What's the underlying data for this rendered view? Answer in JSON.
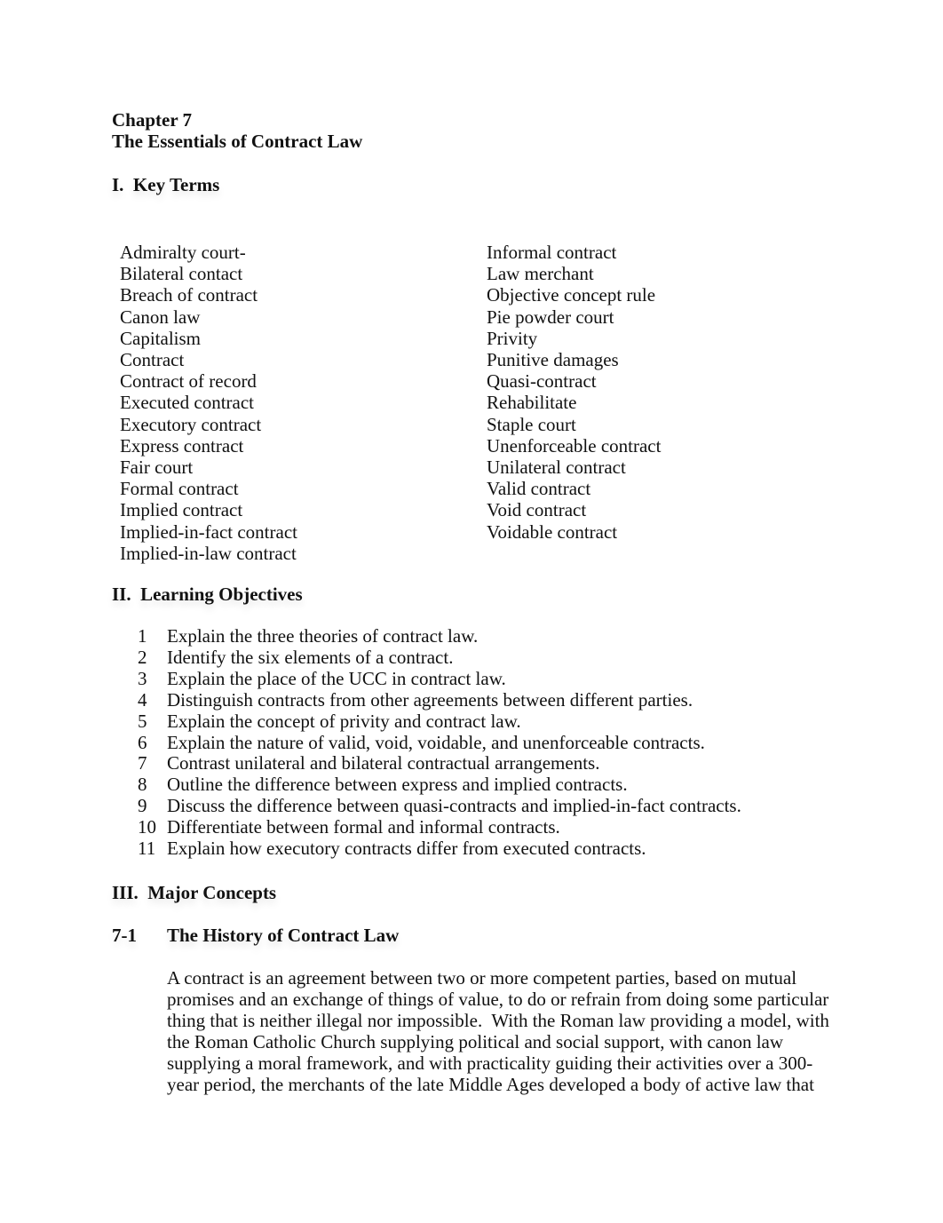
{
  "document": {
    "chapter": "Chapter 7",
    "title": "The Essentials of Contract Law"
  },
  "sections": {
    "key_terms": {
      "heading": "I.  Key Terms",
      "left_column": [
        "Admiralty court-",
        "Bilateral contact",
        "Breach of contract",
        "Canon law",
        "Capitalism",
        "Contract",
        "Contract of record",
        "Executed contract",
        "Executory contract",
        "Express contract",
        "Fair court",
        "Formal contract",
        "Implied contract",
        "Implied-in-fact contract",
        "Implied-in-law contract"
      ],
      "right_column": [
        "Informal contract",
        "Law merchant",
        "Objective concept rule",
        "Pie powder court",
        "Privity",
        "Punitive damages",
        "Quasi-contract",
        "Rehabilitate",
        "Staple court",
        "Unenforceable contract",
        "Unilateral contract",
        "Valid contract",
        "Void contract",
        "Voidable contract"
      ]
    },
    "learning_objectives": {
      "heading": "II.  Learning Objectives",
      "items": [
        {
          "num": "1",
          "text": "Explain the three theories of contract law."
        },
        {
          "num": "2",
          "text": "Identify the six elements of a contract."
        },
        {
          "num": "3",
          "text": "Explain the place of the UCC in contract law."
        },
        {
          "num": "4",
          "text": "Distinguish contracts from other agreements between different parties."
        },
        {
          "num": "5",
          "text": "Explain the concept of privity and contract law."
        },
        {
          "num": "6",
          "text": "Explain the nature of valid, void, voidable, and unenforceable contracts."
        },
        {
          "num": "7",
          "text": "Contrast unilateral and bilateral contractual arrangements."
        },
        {
          "num": "8",
          "text": "Outline the difference between express and implied contracts."
        },
        {
          "num": "9",
          "text": "Discuss the difference between quasi-contracts and implied-in-fact contracts."
        },
        {
          "num": "10",
          "text": "Differentiate between formal and informal contracts."
        },
        {
          "num": "11",
          "text": "Explain how executory contracts differ from executed contracts."
        }
      ]
    },
    "major_concepts": {
      "heading": "III.  Major Concepts",
      "subsection": {
        "number": "7-1",
        "title": "The History of Contract Law",
        "paragraph_lines": [
          "A contract is an agreement between two or more competent parties, based on mutual",
          "promises and an exchange of things of value, to do or refrain from doing some particular",
          "thing that is neither illegal nor impossible.  With the Roman law providing a model, with",
          "the Roman Catholic Church supplying political and social support, with canon law",
          "supplying a moral framework, and with practicality guiding their activities over a 300-",
          "year period, the merchants of the late Middle Ages developed a body of active law that"
        ]
      }
    }
  }
}
